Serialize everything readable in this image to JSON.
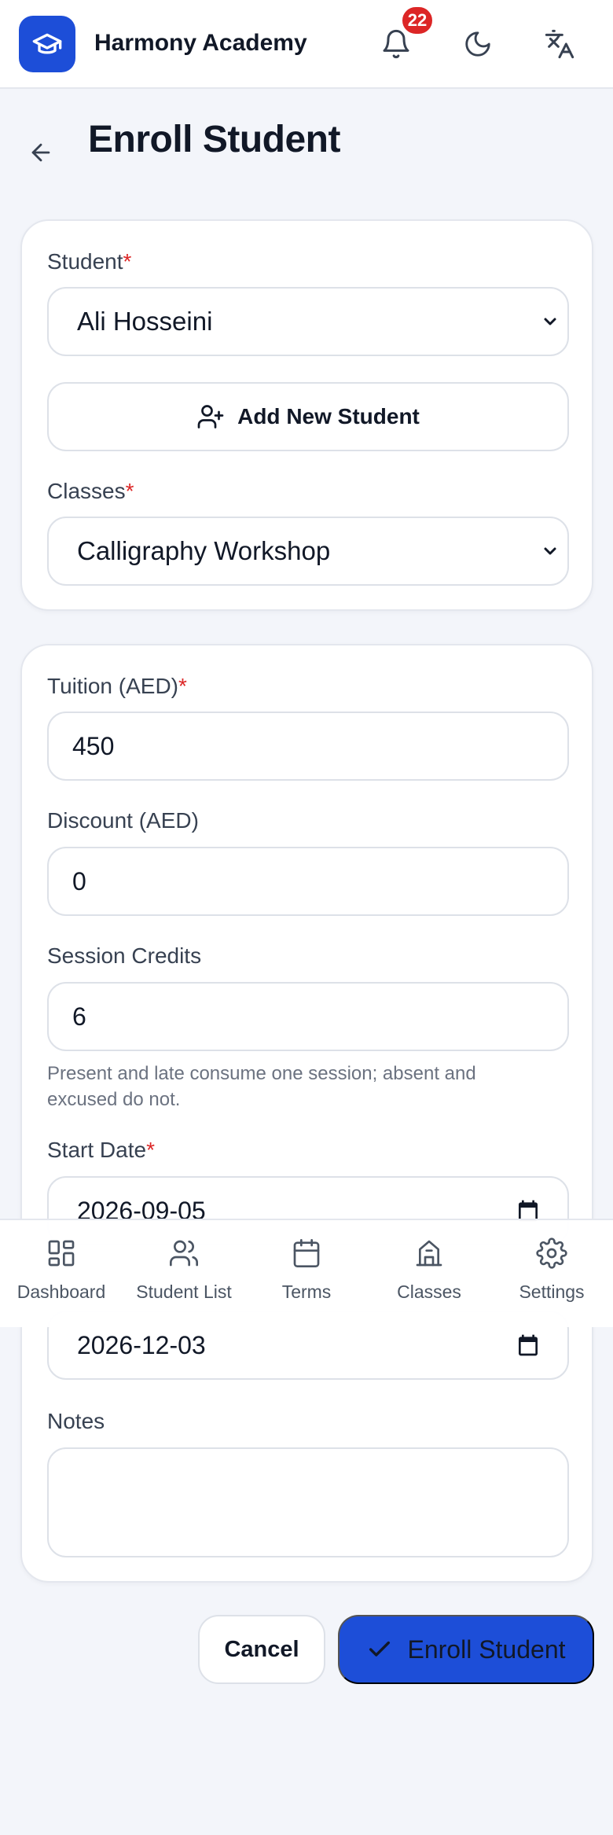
{
  "app": {
    "title": "Harmony Academy",
    "notification_count": "22"
  },
  "page": {
    "title": "Enroll Student"
  },
  "form": {
    "student_label": "Student",
    "student_value": "Ali Hosseini",
    "add_student_label": "Add New Student",
    "classes_label": "Classes",
    "classes_value": "Calligraphy Workshop",
    "tuition_label": "Tuition (AED)",
    "tuition_value": "450",
    "discount_label": "Discount (AED)",
    "discount_value": "0",
    "credits_label": "Session Credits",
    "credits_value": "6",
    "credits_help": "Present and late consume one session; absent and excused do not.",
    "start_label": "Start Date",
    "start_value": "2026-09-05",
    "end_value": "2026-12-03",
    "notes_label": "Notes",
    "notes_value": "",
    "required_mark": "*"
  },
  "nav": {
    "items": [
      {
        "label": "Dashboard",
        "icon": "dashboard-icon"
      },
      {
        "label": "Student List",
        "icon": "users-icon"
      },
      {
        "label": "Terms",
        "icon": "calendar-icon"
      },
      {
        "label": "Classes",
        "icon": "building-icon"
      },
      {
        "label": "Settings",
        "icon": "gear-icon"
      }
    ]
  },
  "actions": {
    "cancel_label": "Cancel",
    "submit_label": "Enroll Student"
  },
  "colors": {
    "primary": "#1d4ed8",
    "danger": "#dc2626",
    "background": "#f3f5fa"
  }
}
